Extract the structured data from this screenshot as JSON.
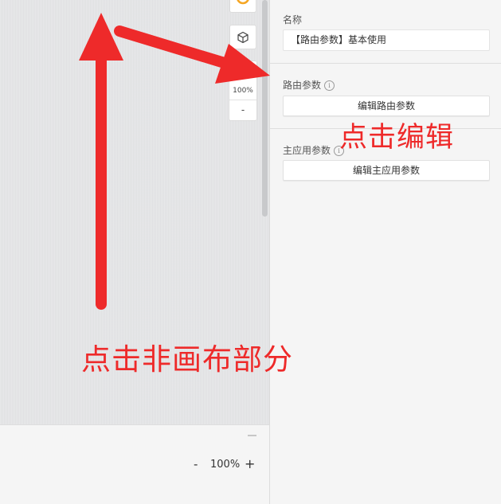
{
  "canvas": {
    "toolbar": {
      "orange_tool_icon": "orange-tool-icon",
      "cube_icon": "cube-icon",
      "zoom_percent": "100%",
      "zoom_minus": "-"
    }
  },
  "bottom_bar": {
    "zoom_minus": "-",
    "zoom_percent": "100%",
    "zoom_plus": "+"
  },
  "panel": {
    "name_label": "名称",
    "name_value": "【路由参数】基本使用",
    "route_params_label": "路由参数",
    "edit_route_params_button": "编辑路由参数",
    "main_app_params_label": "主应用参数",
    "edit_main_app_params_button": "编辑主应用参数"
  },
  "annotations": {
    "click_edit": "点击编辑",
    "click_blank": "点击非画布部分",
    "color": "#ee2a2a"
  },
  "colors": {
    "accent_orange": "#f5a623",
    "canvas_bg": "#e3e4e6",
    "panel_bg": "#f5f5f5"
  }
}
